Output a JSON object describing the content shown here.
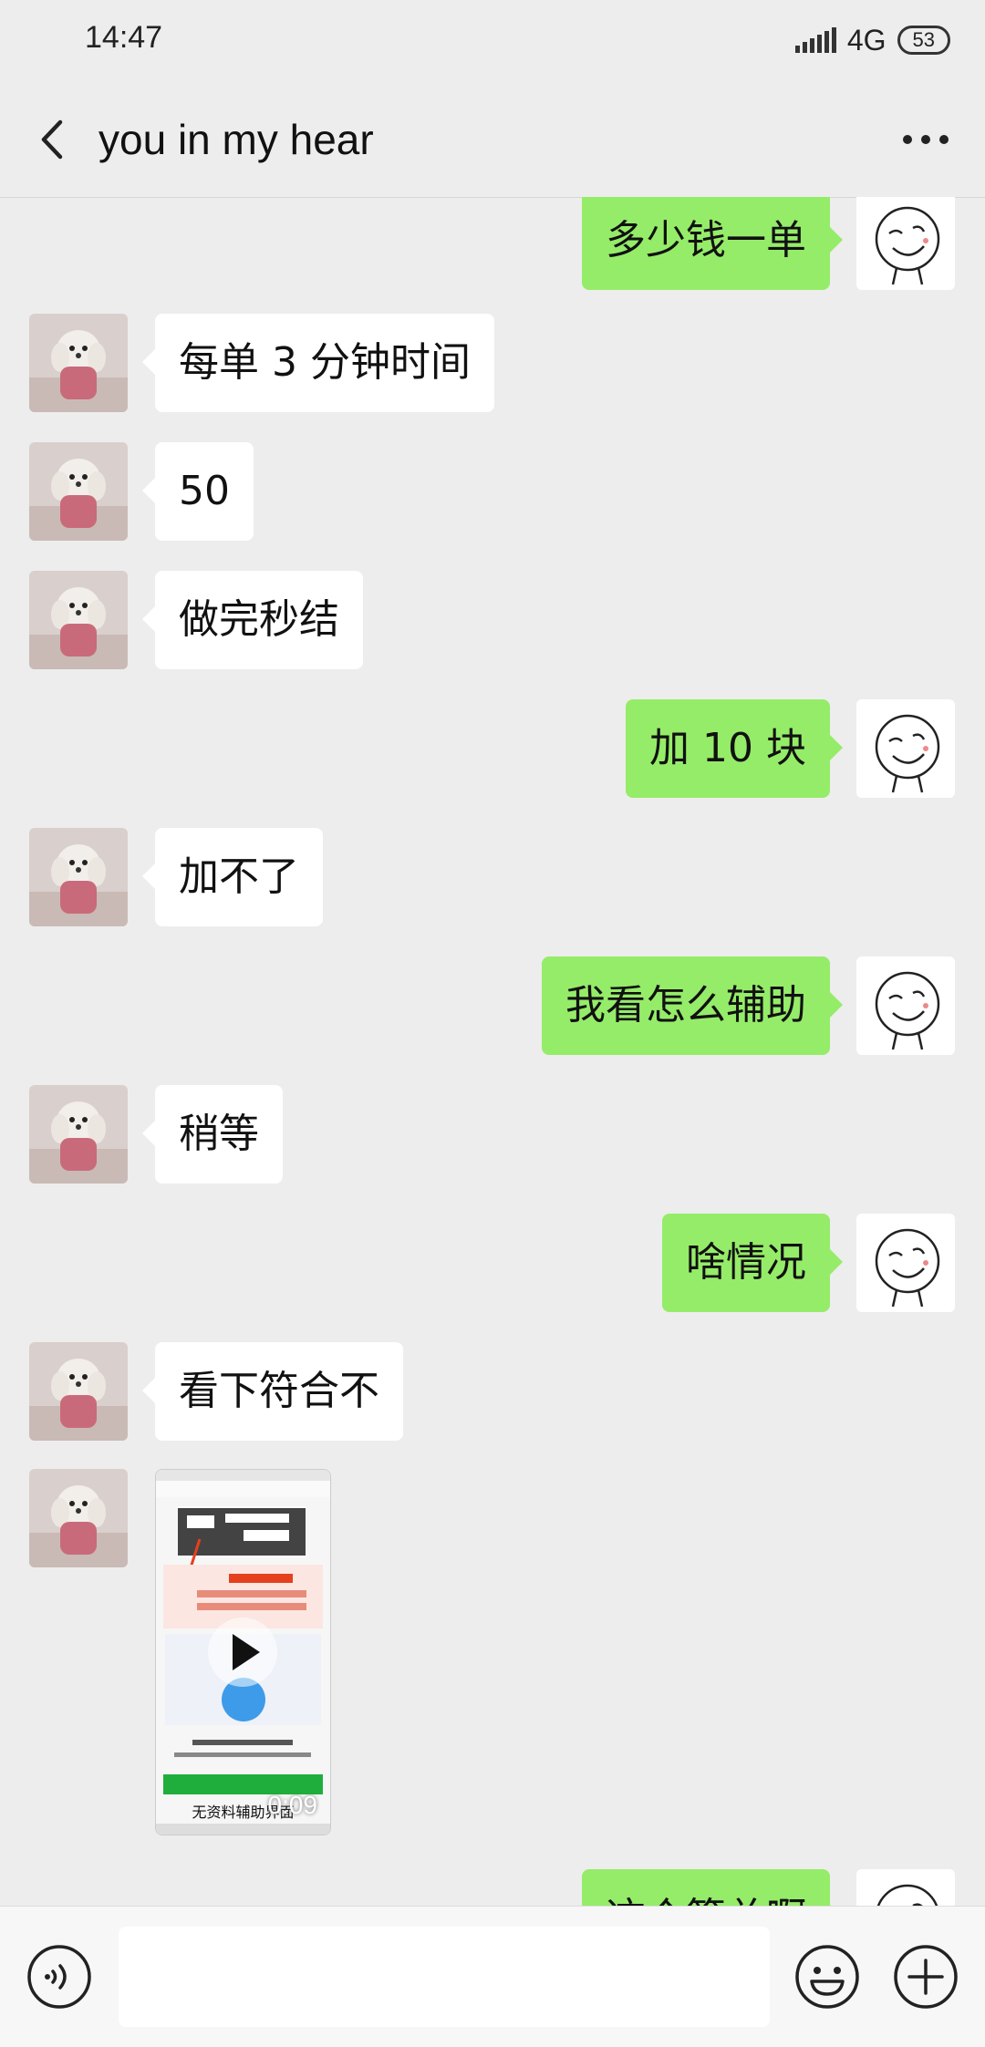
{
  "status_bar": {
    "time": "14:47",
    "network": "4G",
    "battery": "53"
  },
  "header": {
    "title": "you in my hear",
    "back_icon": "chevron-left-icon",
    "more_icon": "more-icon"
  },
  "messages": [
    {
      "side": "right",
      "text": "多少钱一单"
    },
    {
      "side": "left",
      "text": "每单 3 分钟时间"
    },
    {
      "side": "left",
      "text": "50"
    },
    {
      "side": "left",
      "text": "做完秒结"
    },
    {
      "side": "right",
      "text": "加 10 块"
    },
    {
      "side": "left",
      "text": "加不了"
    },
    {
      "side": "right",
      "text": "我看怎么辅助"
    },
    {
      "side": "left",
      "text": "稍等"
    },
    {
      "side": "right",
      "text": "啥情况"
    },
    {
      "side": "left",
      "text": "看下符合不"
    },
    {
      "side": "left",
      "type": "video",
      "duration": "0:09",
      "caption": "无资料辅助界面"
    },
    {
      "side": "right",
      "text": "这个算总啊"
    }
  ],
  "input_bar": {
    "voice_icon": "voice-icon",
    "emoji_icon": "emoji-icon",
    "plus_icon": "plus-icon",
    "value": ""
  },
  "colors": {
    "background": "#ededed",
    "sent_bubble": "#95ec69",
    "received_bubble": "#ffffff"
  }
}
